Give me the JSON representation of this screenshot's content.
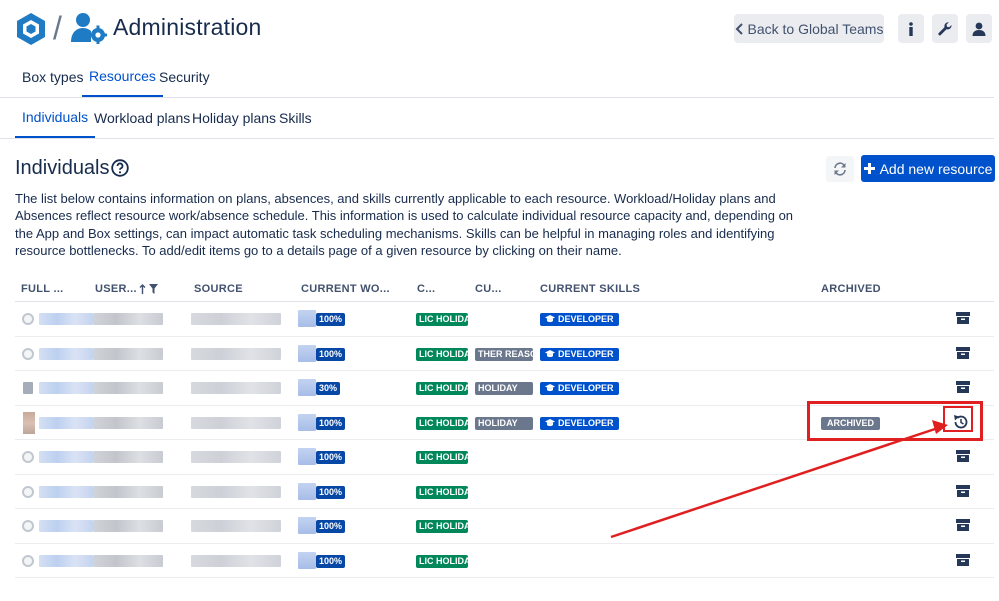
{
  "header": {
    "title": "Administration",
    "back_label": "Back to Global Teams",
    "logo_icon": "cube-logo-icon",
    "admin_icon": "user-gear-icon"
  },
  "tabs_main": [
    {
      "label": "Box types",
      "active": false
    },
    {
      "label": "Resources",
      "active": true
    },
    {
      "label": "Security",
      "active": false
    }
  ],
  "tabs_sub": [
    {
      "label": "Individuals",
      "active": true
    },
    {
      "label": "Workload plans",
      "active": false
    },
    {
      "label": "Holiday plans",
      "active": false
    },
    {
      "label": "Skills",
      "active": false
    }
  ],
  "section": {
    "title": "Individuals",
    "add_label": "Add new resource",
    "description": "The list below contains information on plans, absences, and skills currently applicable to each resource. Workload/Holiday plans and Absences reflect resource work/absence schedule. This information is used to calculate individual resource capacity and, depending on the App and Box settings, can impact automatic task scheduling mechanisms. Skills can be helpful in managing roles and identifying resource bottlenecks. To add/edit items go to a details page of a given resource by clicking on their name."
  },
  "table": {
    "headers": {
      "full_name": "FULL ...",
      "user": "USER...",
      "source": "SOURCE",
      "current_wo": "CURRENT WO...",
      "c": "C...",
      "cu": "CU...",
      "skills": "CURRENT SKILLS",
      "archived": "ARCHIVED"
    },
    "rows": [
      {
        "avatar": "circle",
        "workload": "100%",
        "holiday": "LIC HOLIDAY",
        "absence": "",
        "skill": "DEVELOPER",
        "archived": ""
      },
      {
        "avatar": "circle",
        "workload": "100%",
        "holiday": "LIC HOLIDAY",
        "absence": "THER REASO",
        "skill": "DEVELOPER",
        "archived": ""
      },
      {
        "avatar": "doc",
        "workload": "30%",
        "holiday": "LIC HOLIDAY",
        "absence": "HOLIDAY",
        "skill": "DEVELOPER",
        "archived": ""
      },
      {
        "avatar": "photo",
        "workload": "100%",
        "holiday": "LIC HOLIDAY",
        "absence": "HOLIDAY",
        "skill": "DEVELOPER",
        "archived": "ARCHIVED"
      },
      {
        "avatar": "circle",
        "workload": "100%",
        "holiday": "LIC HOLIDAY",
        "absence": "",
        "skill": "",
        "archived": ""
      },
      {
        "avatar": "circle",
        "workload": "100%",
        "holiday": "LIC HOLIDAY",
        "absence": "",
        "skill": "",
        "archived": ""
      },
      {
        "avatar": "circle",
        "workload": "100%",
        "holiday": "LIC HOLIDAY",
        "absence": "",
        "skill": "",
        "archived": ""
      },
      {
        "avatar": "circle",
        "workload": "100%",
        "holiday": "LIC HOLIDAY",
        "absence": "",
        "skill": "",
        "archived": ""
      }
    ]
  },
  "colors": {
    "primary": "#0052cc",
    "success": "#00875a",
    "neutral": "#6b778c",
    "annotation": "#e02020"
  }
}
